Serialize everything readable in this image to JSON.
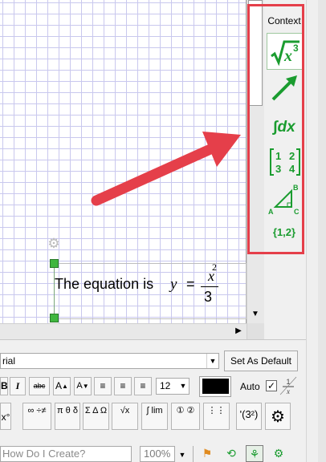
{
  "canvas": {
    "equation_text": "The equation is",
    "equation_variable": "y",
    "equation_equals": "=",
    "fraction_numerator": "x",
    "fraction_exponent": "2",
    "fraction_denominator": "3"
  },
  "context_panel": {
    "title": "Context",
    "tools": [
      {
        "name": "sqrt-x3-icon",
        "label": "√x3"
      },
      {
        "name": "vector-arrow-icon"
      },
      {
        "name": "integral-dx-icon",
        "label": "∫dx"
      },
      {
        "name": "matrix-icon",
        "cells": [
          "1",
          "2",
          "3",
          "4"
        ]
      },
      {
        "name": "triangle-abc-icon",
        "vertices": [
          "A",
          "B",
          "C"
        ]
      },
      {
        "name": "set-braces-icon",
        "label": "{1,2}"
      }
    ],
    "accent_color": "#1a9c2f",
    "highlight_color": "#e53f4a"
  },
  "toolbar": {
    "font_value": "rial",
    "set_default_label": "Set As Default",
    "bold_label": "B",
    "italic_label": "I",
    "strike_label": "abc",
    "grow_label": "A",
    "shrink_label": "A",
    "size_value": "12",
    "auto_label": "Auto",
    "auto_checked": "✓",
    "math_buttons": [
      "x°",
      "∞ ÷≠",
      "π θ δ",
      "Σ Δ Ω",
      "√x",
      "∫ lim",
      "① ②",
      "⋮⋮",
      "'(3²)",
      "⚙"
    ]
  },
  "statusbar": {
    "search_placeholder": "How Do I Create?",
    "zoom_value": "100%"
  }
}
